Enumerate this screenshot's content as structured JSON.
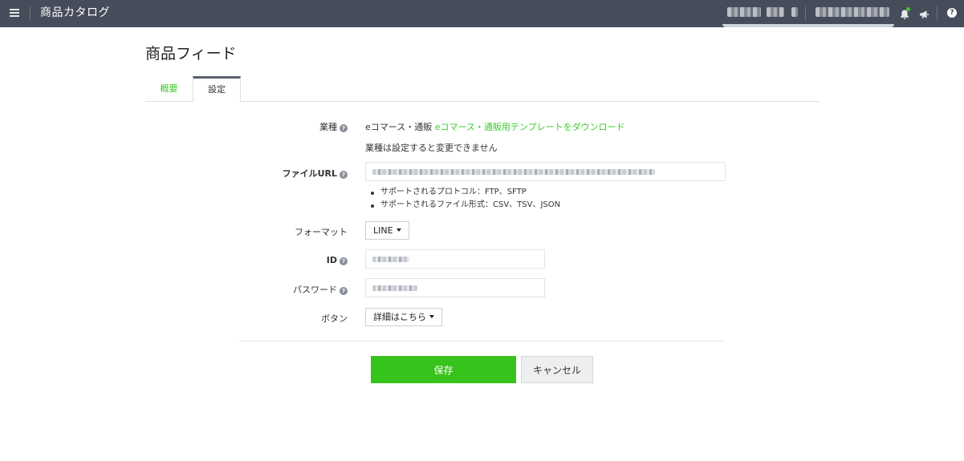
{
  "header": {
    "app_title": "商品カタログ",
    "help_label": "?"
  },
  "page": {
    "title": "商品フィード"
  },
  "tabs": [
    {
      "label": "概要",
      "active": false
    },
    {
      "label": "設定",
      "active": true
    }
  ],
  "form": {
    "industry": {
      "label": "業種",
      "value": "eコマース・通販",
      "template_link": "eコマース・通販用テンプレートをダウンロード",
      "note": "業種は設定すると変更できません"
    },
    "file_url": {
      "label": "ファイルURL",
      "notes": [
        "サポートされるプロトコル：FTP、SFTP",
        "サポートされるファイル形式：CSV、TSV、JSON"
      ]
    },
    "format": {
      "label": "フォーマット",
      "selected": "LINE"
    },
    "id": {
      "label": "ID"
    },
    "password": {
      "label": "パスワード"
    },
    "button": {
      "label": "ボタン",
      "selected": "詳細はこちら"
    }
  },
  "actions": {
    "save_label": "保存",
    "cancel_label": "キャンセル"
  },
  "colors": {
    "topbar": "#464c59",
    "accent_green": "#36c31b",
    "link_green": "#3acc2a"
  },
  "icons": {
    "menu": "hamburger-icon",
    "notifications": "bell-icon",
    "announcements": "megaphone-icon",
    "help": "question-circle-icon"
  }
}
